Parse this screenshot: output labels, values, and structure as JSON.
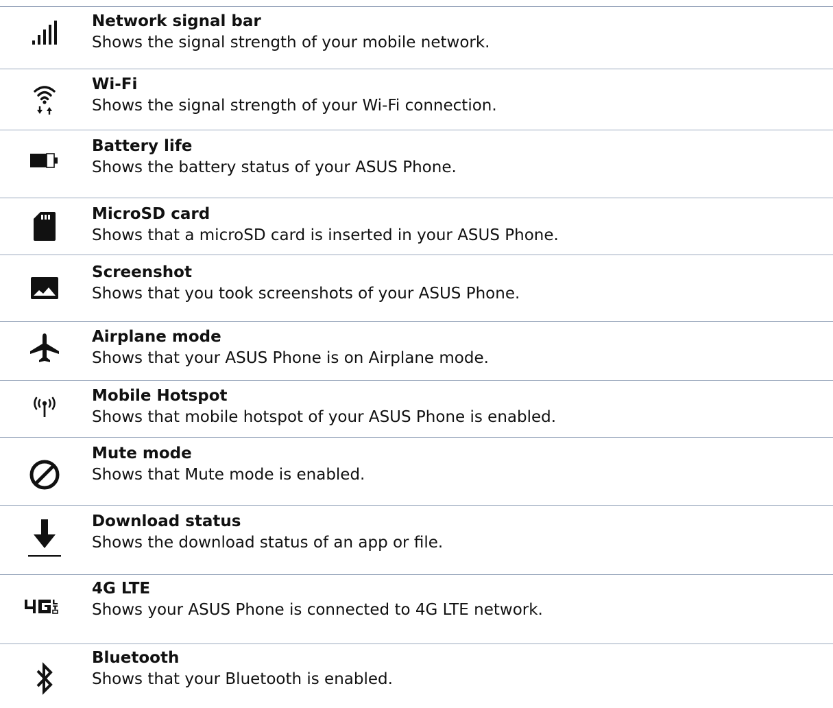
{
  "items": [
    {
      "icon": "signal-bars-icon",
      "title": "Network signal bar",
      "description": "Shows the signal strength of your mobile network."
    },
    {
      "icon": "wifi-icon",
      "title": "Wi-Fi",
      "description": "Shows the signal strength of your Wi-Fi connection."
    },
    {
      "icon": "battery-icon",
      "title": "Battery life",
      "description": "Shows the battery status of your ASUS Phone."
    },
    {
      "icon": "sd-card-icon",
      "title": "MicroSD card",
      "description": "Shows that a microSD card is inserted in your ASUS Phone."
    },
    {
      "icon": "image-icon",
      "title": "Screenshot",
      "description": "Shows that you took screenshots of your ASUS Phone."
    },
    {
      "icon": "airplane-icon",
      "title": "Airplane mode",
      "description": "Shows that your ASUS Phone is on Airplane mode."
    },
    {
      "icon": "hotspot-icon",
      "title": "Mobile Hotspot",
      "description": "Shows that mobile hotspot of your ASUS Phone is enabled."
    },
    {
      "icon": "mute-icon",
      "title": "Mute mode",
      "description": "Shows that Mute mode is enabled."
    },
    {
      "icon": "download-icon",
      "title": "Download status",
      "description": "Shows the download status of an app or file."
    },
    {
      "icon": "4g-lte-icon",
      "title": "4G LTE",
      "description": "Shows your ASUS Phone is connected to 4G LTE network."
    },
    {
      "icon": "bluetooth-icon",
      "title": "Bluetooth",
      "description": "Shows that your Bluetooth is enabled."
    }
  ]
}
